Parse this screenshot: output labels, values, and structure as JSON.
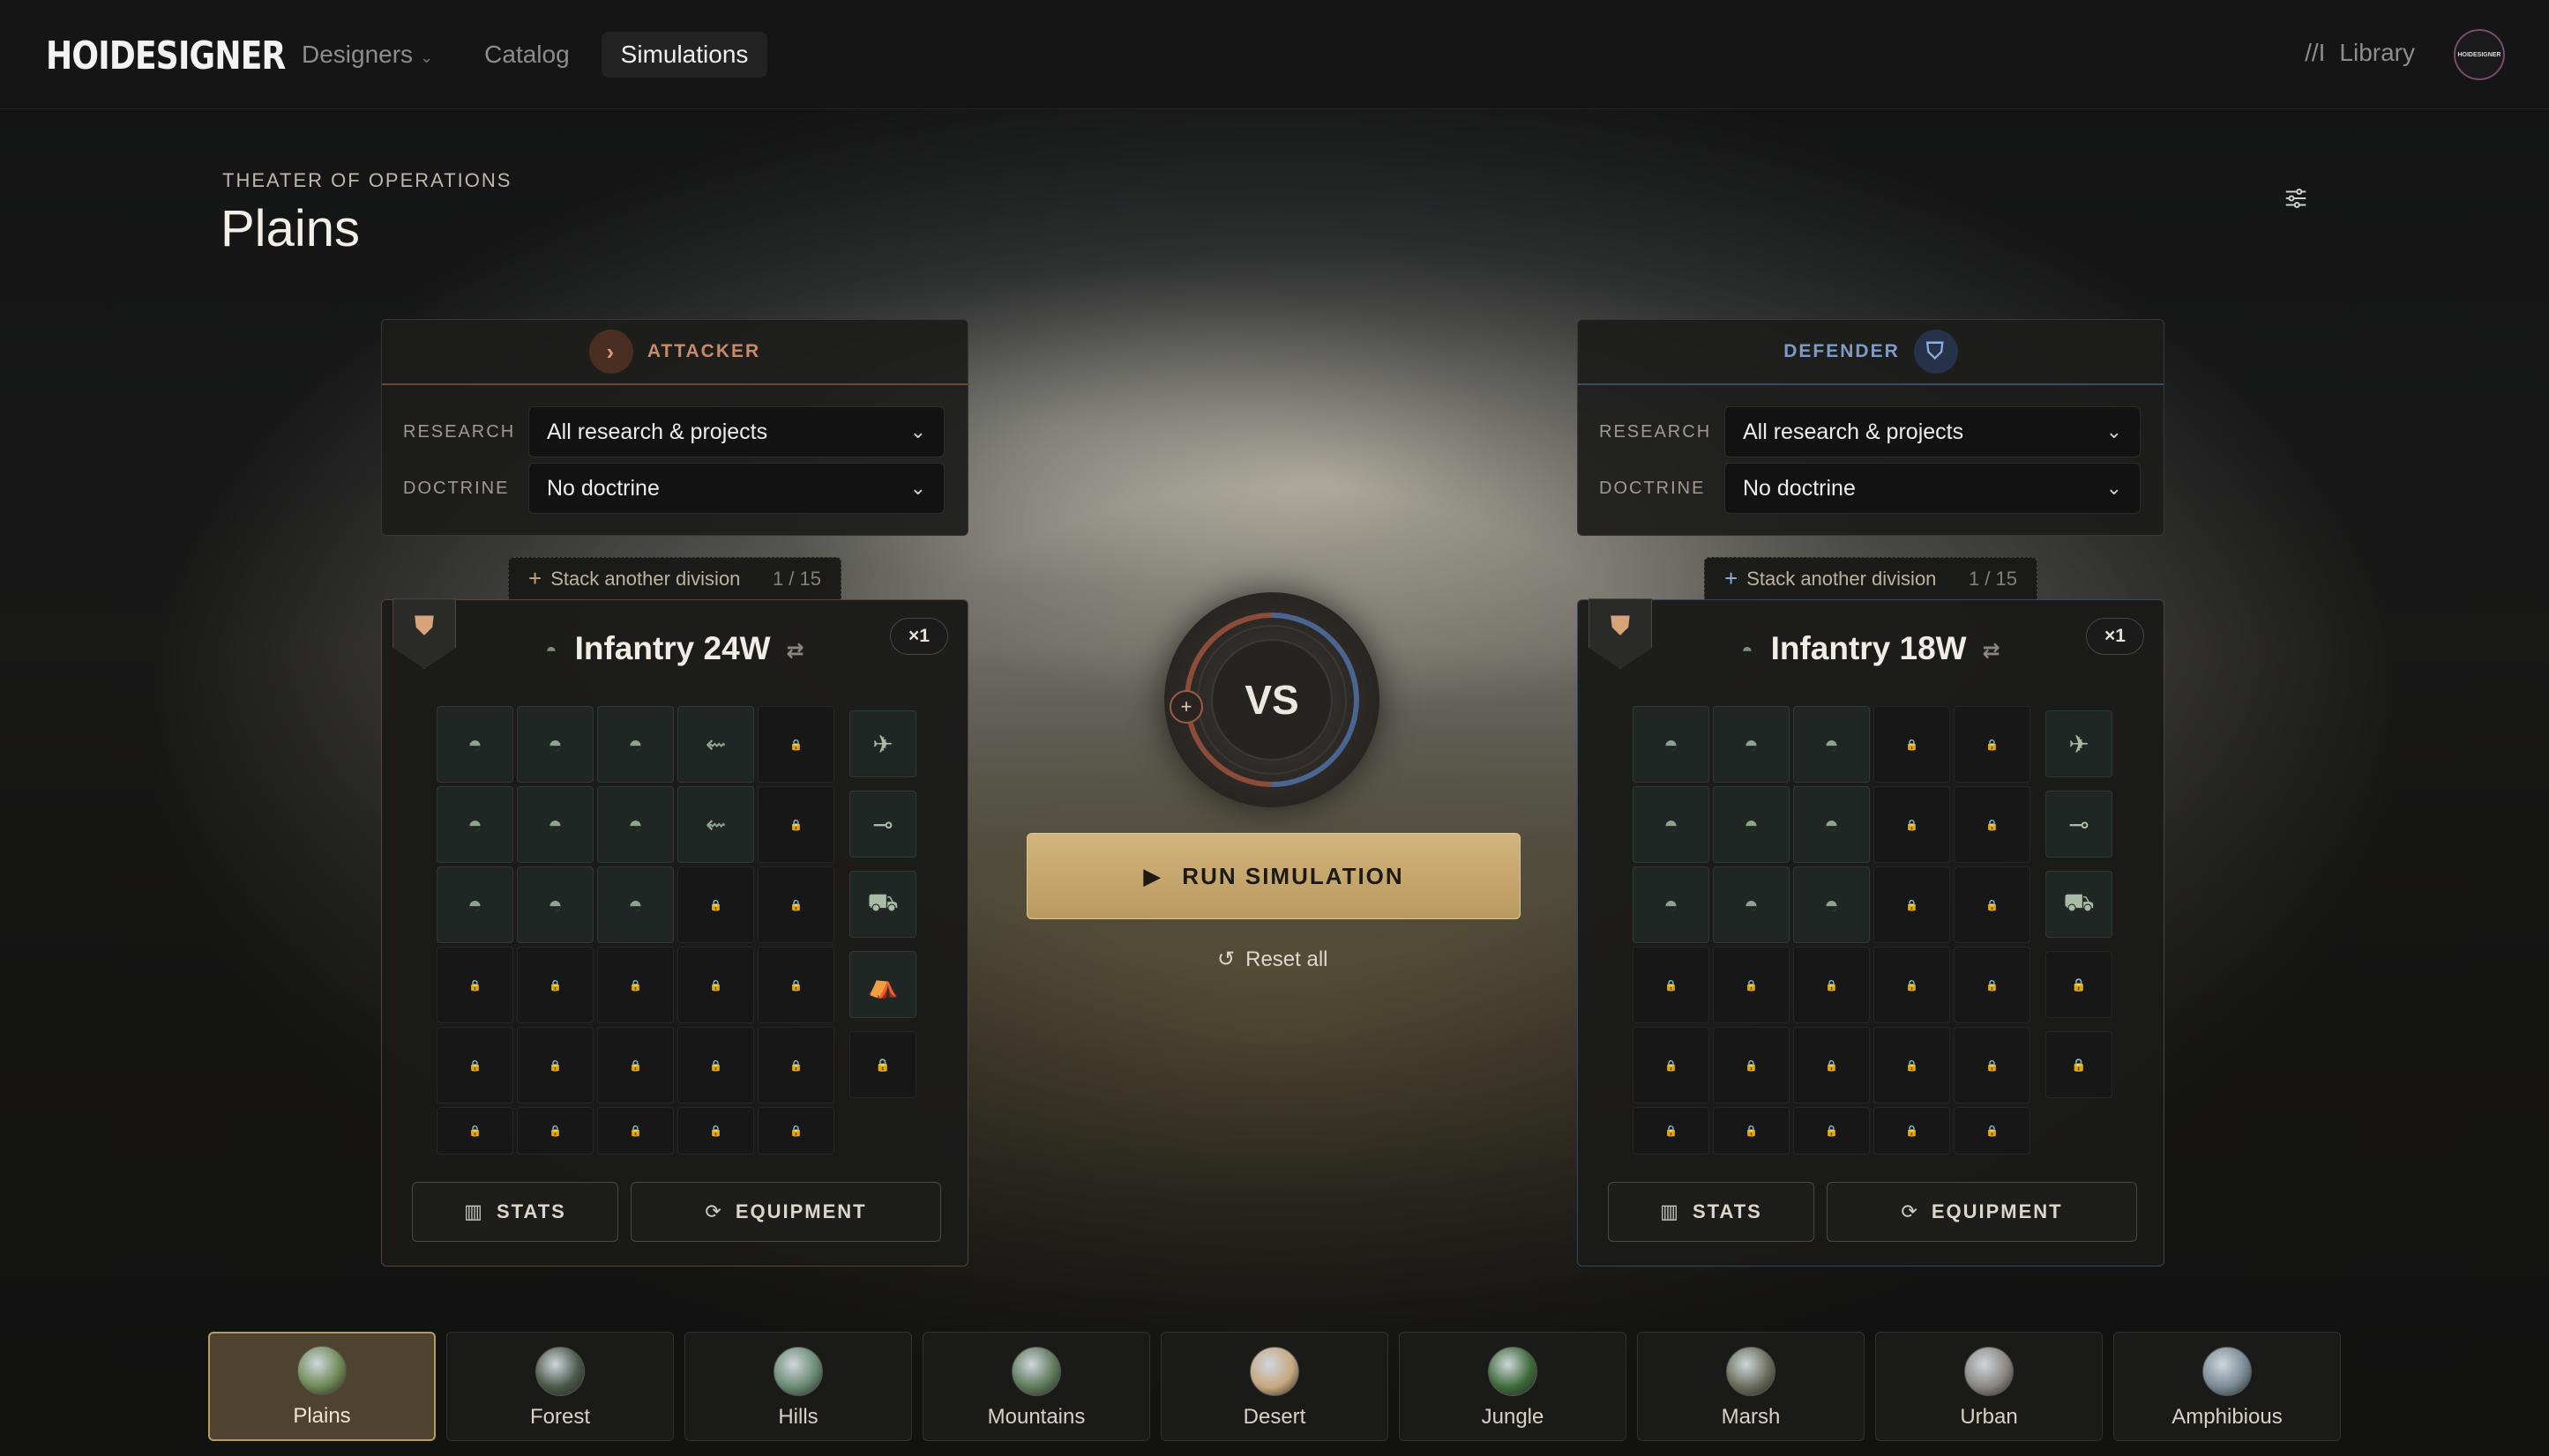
{
  "app": {
    "logo": "HOIDESIGNER",
    "nav": [
      {
        "label": "Designers",
        "has_dropdown": true,
        "active": false
      },
      {
        "label": "Catalog",
        "active": false
      },
      {
        "label": "Simulations",
        "active": true
      }
    ],
    "library_label": "Library",
    "library_icon": "//I",
    "avatar_text": "HOIDESIGNER"
  },
  "theater": {
    "eyebrow": "THEATER OF OPERATIONS",
    "title": "Plains"
  },
  "attacker": {
    "role_label": "ATTACKER",
    "research_label": "RESEARCH",
    "research_value": "All research & projects",
    "doctrine_label": "DOCTRINE",
    "doctrine_value": "No doctrine",
    "stack_label": "Stack another division",
    "stack_count": "1 / 15",
    "division_name": "Infantry 24W",
    "multiplier": "×1",
    "stats_label": "STATS",
    "equipment_label": "EQUIPMENT"
  },
  "defender": {
    "role_label": "DEFENDER",
    "research_label": "RESEARCH",
    "research_value": "All research & projects",
    "doctrine_label": "DOCTRINE",
    "doctrine_value": "No doctrine",
    "stack_label": "Stack another division",
    "stack_count": "1 / 15",
    "division_name": "Infantry 18W",
    "multiplier": "×1",
    "stats_label": "STATS",
    "equipment_label": "EQUIPMENT"
  },
  "center": {
    "vs_label": "VS",
    "run_label": "RUN SIMULATION",
    "reset_label": "Reset all"
  },
  "terrain": [
    {
      "label": "Plains",
      "active": true,
      "color": "#6f8a55"
    },
    {
      "label": "Forest",
      "active": false,
      "color": "#4a5848"
    },
    {
      "label": "Hills",
      "active": false,
      "color": "#6b8a72"
    },
    {
      "label": "Mountains",
      "active": false,
      "color": "#5d7a5a"
    },
    {
      "label": "Desert",
      "active": false,
      "color": "#c7a77e"
    },
    {
      "label": "Jungle",
      "active": false,
      "color": "#3f6a3a"
    },
    {
      "label": "Marsh",
      "active": false,
      "color": "#6a6c5a"
    },
    {
      "label": "Urban",
      "active": false,
      "color": "#8a8680"
    },
    {
      "label": "Amphibious",
      "active": false,
      "color": "#7a8a94"
    }
  ],
  "colors": {
    "attacker_accent": "#c98a6a",
    "defender_accent": "#7e9bc6",
    "run_button": "#c8ab72"
  }
}
